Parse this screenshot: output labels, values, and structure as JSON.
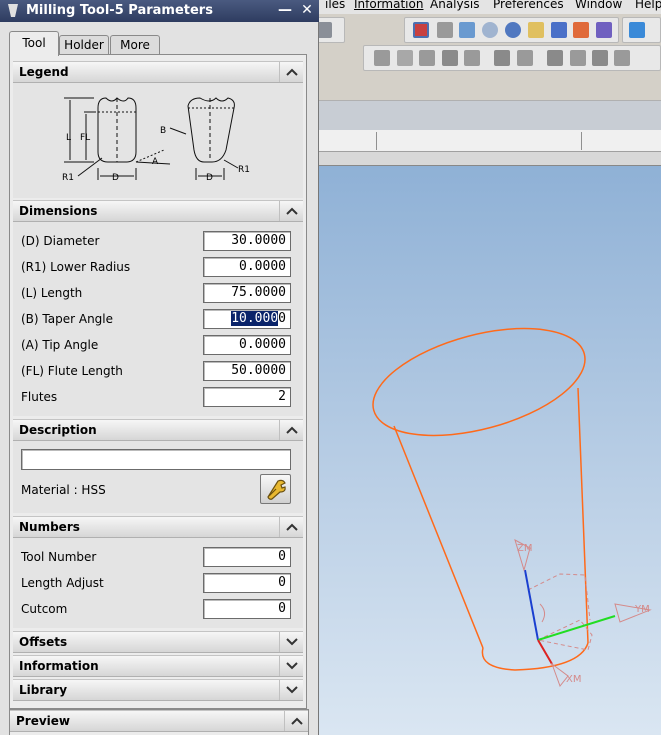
{
  "menu": [
    "iles",
    "Information",
    "Analysis",
    "Preferences",
    "Window",
    "Help"
  ],
  "dialog": {
    "title": "Milling Tool-5 Parameters",
    "window_buttons": {
      "minimize": "—",
      "close": "✕"
    },
    "tabs": [
      "Tool",
      "Holder",
      "More"
    ],
    "active_tab": "Tool"
  },
  "legend": {
    "title": "Legend",
    "labels": {
      "L": "L",
      "FL": "FL",
      "R1": "R1",
      "D": "D",
      "A": "A",
      "B": "B"
    }
  },
  "dimensions": {
    "title": "Dimensions",
    "fields": [
      {
        "label": "(D) Diameter",
        "value": "30.0000"
      },
      {
        "label": "(R1) Lower Radius",
        "value": "0.0000"
      },
      {
        "label": "(L) Length",
        "value": "75.0000"
      },
      {
        "label": "(B) Taper Angle",
        "value_selected": "10.000",
        "value_rest": "0"
      },
      {
        "label": "(A) Tip Angle",
        "value": "0.0000"
      },
      {
        "label": "(FL) Flute Length",
        "value": "50.0000"
      },
      {
        "label": "Flutes",
        "value": "2"
      }
    ]
  },
  "description": {
    "title": "Description",
    "text": "",
    "material_label": "Material : HSS"
  },
  "numbers": {
    "title": "Numbers",
    "fields": [
      {
        "label": "Tool Number",
        "value": "0"
      },
      {
        "label": "Length Adjust",
        "value": "0"
      },
      {
        "label": "Cutcom",
        "value": "0"
      }
    ]
  },
  "collapsed_sections": [
    "Offsets",
    "Information",
    "Library"
  ],
  "preview": {
    "title": "Preview"
  },
  "viewport": {
    "axis_labels": {
      "z": "ZM",
      "y": "YM",
      "x": "XM"
    },
    "tool_color": "#ff6a1a",
    "axis_colors": {
      "z": "#1a3fd0",
      "y": "#22dd22",
      "x": "#dd2222"
    },
    "triad_color": "#d48a8a"
  },
  "colors": {
    "title_bar": "#2e3c60",
    "selection": "#0a246a",
    "panel": "#ececec"
  }
}
